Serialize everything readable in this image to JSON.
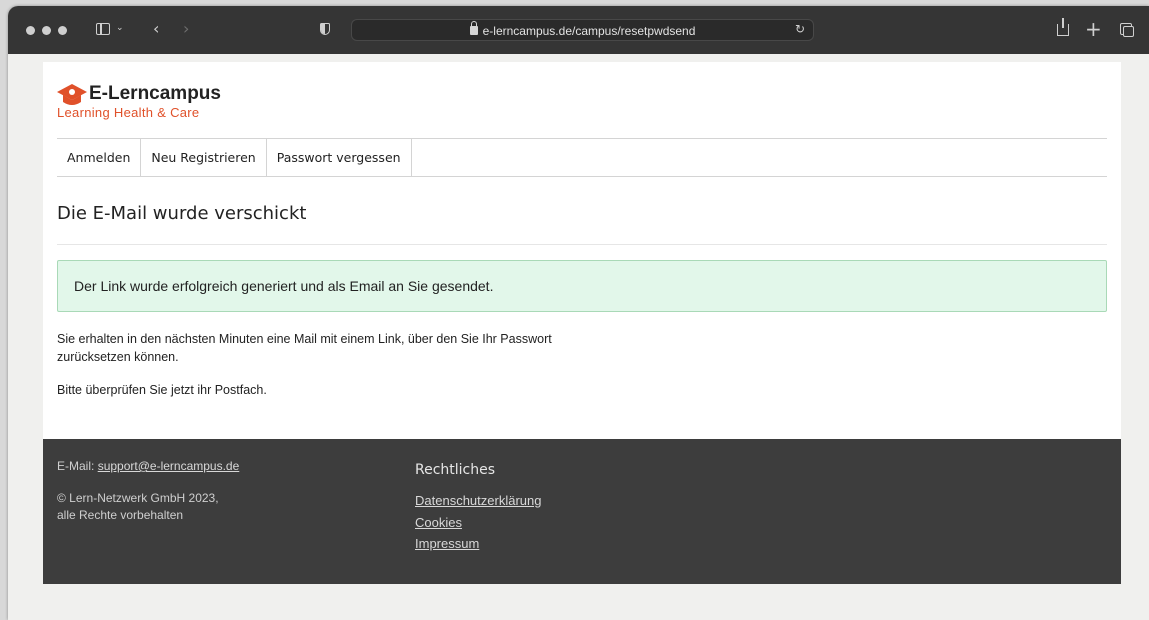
{
  "browser": {
    "url": "e-lerncampus.de/campus/resetpwdsend"
  },
  "brand": {
    "name": "E-Lerncampus",
    "tagline": "Learning Health & Care",
    "accent_color": "#e0512a"
  },
  "nav": {
    "items": [
      {
        "label": "Anmelden"
      },
      {
        "label": "Neu Registrieren"
      },
      {
        "label": "Passwort vergessen"
      }
    ]
  },
  "main": {
    "title": "Die E-Mail wurde verschickt",
    "alert": "Der Link wurde erfolgreich generiert und als Email an Sie gesendet.",
    "paragraph1": "Sie erhalten in den nächsten Minuten eine Mail mit einem Link, über den Sie Ihr Passwort zurücksetzen können.",
    "paragraph2": "Bitte überprüfen Sie jetzt ihr Postfach."
  },
  "footer": {
    "email_label": "E-Mail:",
    "email": "support@e-lerncampus.de",
    "copyright_line1": "© Lern-Netzwerk GmbH 2023,",
    "copyright_line2": "alle Rechte vorbehalten",
    "legal_heading": "Rechtliches",
    "links": [
      {
        "label": "Datenschutzerklärung"
      },
      {
        "label": "Cookies"
      },
      {
        "label": "Impressum"
      }
    ]
  }
}
